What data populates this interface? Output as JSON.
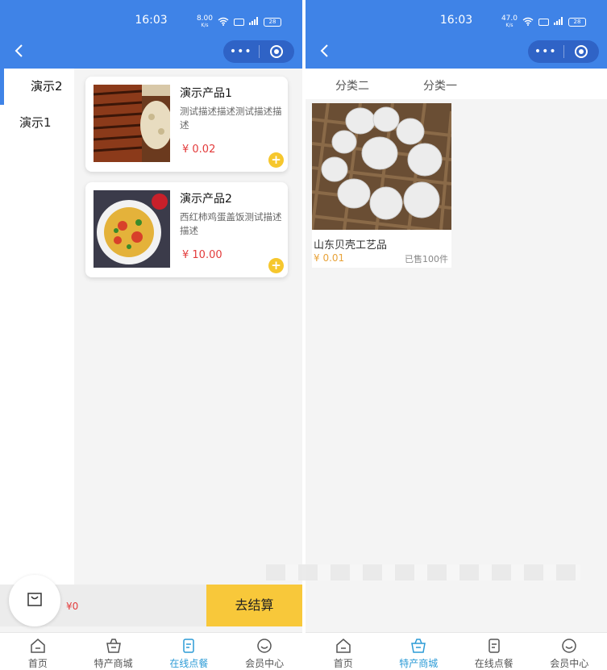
{
  "screens": {
    "left": {
      "status": {
        "time": "16:03",
        "net_speed_value": "8.00",
        "net_speed_unit": "K/s",
        "battery": "28"
      },
      "categories": [
        {
          "label": "演示2",
          "active": true
        },
        {
          "label": "演示1",
          "active": false
        }
      ],
      "products": [
        {
          "name": "演示产品1",
          "desc": "测试描述描述测试描述描述",
          "price": "¥ 0.02",
          "image": "grilled-eel-rice-photo"
        },
        {
          "name": "演示产品2",
          "desc": "西红柿鸡蛋盖饭测试描述描述",
          "price": "¥ 10.00",
          "image": "tomato-egg-rice-photo"
        }
      ],
      "cart": {
        "total": "¥0",
        "checkout_label": "去结算"
      },
      "tabbar": [
        {
          "label": "首页",
          "icon": "home-icon",
          "active": false
        },
        {
          "label": "特产商城",
          "icon": "basket-icon",
          "active": false
        },
        {
          "label": "在线点餐",
          "icon": "menu-icon",
          "active": true
        },
        {
          "label": "会员中心",
          "icon": "member-icon",
          "active": false
        }
      ]
    },
    "right": {
      "status": {
        "time": "16:03",
        "net_speed_value": "47.0",
        "net_speed_unit": "K/s",
        "battery": "28"
      },
      "subtabs": [
        {
          "label": "分类二"
        },
        {
          "label": "分类一"
        }
      ],
      "goods": [
        {
          "name": "山东贝壳工艺品",
          "price": "¥ 0.01",
          "sold": "已售100件",
          "image": "scallop-shells-photo"
        }
      ],
      "tabbar": [
        {
          "label": "首页",
          "icon": "home-icon",
          "active": false
        },
        {
          "label": "特产商城",
          "icon": "basket-icon",
          "active": true
        },
        {
          "label": "在线点餐",
          "icon": "menu-icon",
          "active": false
        },
        {
          "label": "会员中心",
          "icon": "member-icon",
          "active": false
        }
      ]
    }
  },
  "colors": {
    "brand_blue": "#3f83e7",
    "price_red": "#e33b3b",
    "add_yellow": "#f6c72d",
    "checkout_yellow": "#f8c83a",
    "tab_active": "#2c9bd6",
    "goods_price": "#e8a33a"
  }
}
